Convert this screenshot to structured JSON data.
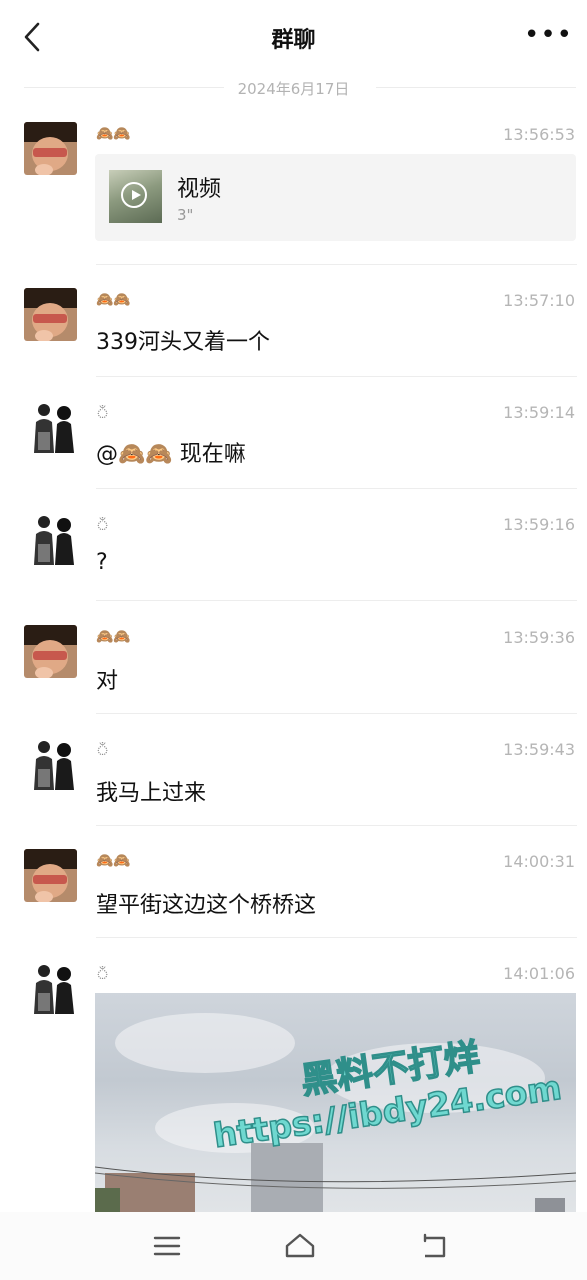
{
  "header": {
    "title": "群聊",
    "more": "•••"
  },
  "date_separator": "2024年6月17日",
  "messages": [
    {
      "sender": "boy",
      "nick": "🙈🙈",
      "time": "13:56:53",
      "type": "video",
      "video_label": "视频",
      "video_duration": "3\""
    },
    {
      "sender": "boy",
      "nick": "🙈🙈",
      "time": "13:57:10",
      "type": "text",
      "text": "339河头又着一个"
    },
    {
      "sender": "couple",
      "nick": "ঁ",
      "time": "13:59:14",
      "type": "text",
      "text": "@🙈🙈 现在嘛"
    },
    {
      "sender": "couple",
      "nick": "ঁ",
      "time": "13:59:16",
      "type": "text",
      "text": "?"
    },
    {
      "sender": "boy",
      "nick": "🙈🙈",
      "time": "13:59:36",
      "type": "text",
      "text": "对"
    },
    {
      "sender": "couple",
      "nick": "ঁ",
      "time": "13:59:43",
      "type": "text",
      "text": "我马上过来"
    },
    {
      "sender": "boy",
      "nick": "🙈🙈",
      "time": "14:00:31",
      "type": "text",
      "text": "望平街这边这个桥桥这"
    },
    {
      "sender": "couple",
      "nick": "ঁ",
      "time": "14:01:06",
      "type": "image"
    }
  ],
  "watermark": {
    "line1": "黑料不打烊",
    "line2": "https://ibdy24.com"
  },
  "navbar": {
    "menu_icon": "menu-icon",
    "home_icon": "home-icon",
    "back_icon": "back-icon"
  }
}
